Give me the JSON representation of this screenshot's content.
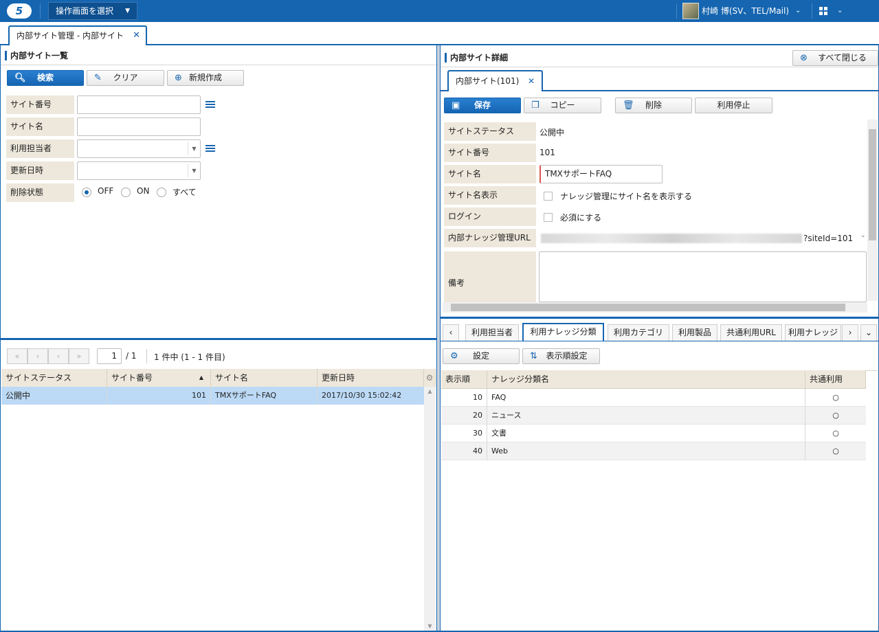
{
  "app": {
    "logo": "5",
    "screen_select": "操作画面を選択",
    "user_name": "村崎 博(SV、TEL/Mail)"
  },
  "main_tab": {
    "label": "内部サイト管理 - 内部サイト"
  },
  "left": {
    "title": "内部サイト一覧",
    "buttons": {
      "search": "検索",
      "clear": "クリア",
      "new": "新規作成"
    },
    "fields": {
      "site_no": "サイト番号",
      "site_name": "サイト名",
      "owner": "利用担当者",
      "updated": "更新日時",
      "deleted": "削除状態"
    },
    "radios": {
      "off": "OFF",
      "on": "ON",
      "all": "すべて"
    },
    "pager": {
      "page": "1",
      "total_pages": "/ 1",
      "count": "1 件中 (1 - 1 件目)"
    },
    "table": {
      "headers": [
        "サイトステータス",
        "サイト番号",
        "サイト名",
        "更新日時"
      ],
      "rows": [
        {
          "status": "公開中",
          "no": "101",
          "name": "TMXサポートFAQ",
          "updated": "2017/10/30 15:02:42"
        }
      ]
    }
  },
  "right": {
    "title": "内部サイト詳細",
    "close_all": "すべて閉じる",
    "detail_tab": "内部サイト(101)",
    "buttons": {
      "save": "保存",
      "copy": "コピー",
      "delete": "削除",
      "stop": "利用停止"
    },
    "fields": {
      "status": {
        "label": "サイトステータス",
        "value": "公開中"
      },
      "site_no": {
        "label": "サイト番号",
        "value": "101"
      },
      "site_name": {
        "label": "サイト名",
        "value": "TMXサポートFAQ"
      },
      "display": {
        "label": "サイト名表示",
        "value": "ナレッジ管理にサイト名を表示する"
      },
      "login": {
        "label": "ログイン",
        "value": "必須にする"
      },
      "url": {
        "label": "内部ナレッジ管理URL",
        "value": "?siteId=101"
      },
      "note": {
        "label": "備考"
      }
    },
    "subtabs": [
      "利用担当者",
      "利用ナレッジ分類",
      "利用カテゴリ",
      "利用製品",
      "共通利用URL",
      "利用ナレッジ"
    ],
    "sub_buttons": {
      "settings": "設定",
      "order": "表示順設定"
    },
    "table": {
      "headers": [
        "表示順",
        "ナレッジ分類名",
        "共通利用"
      ],
      "rows": [
        {
          "order": "10",
          "name": "FAQ",
          "shared": "○"
        },
        {
          "order": "20",
          "name": "ニュース",
          "shared": "○"
        },
        {
          "order": "30",
          "name": "文書",
          "shared": "○"
        },
        {
          "order": "40",
          "name": "Web",
          "shared": "○"
        }
      ]
    }
  }
}
